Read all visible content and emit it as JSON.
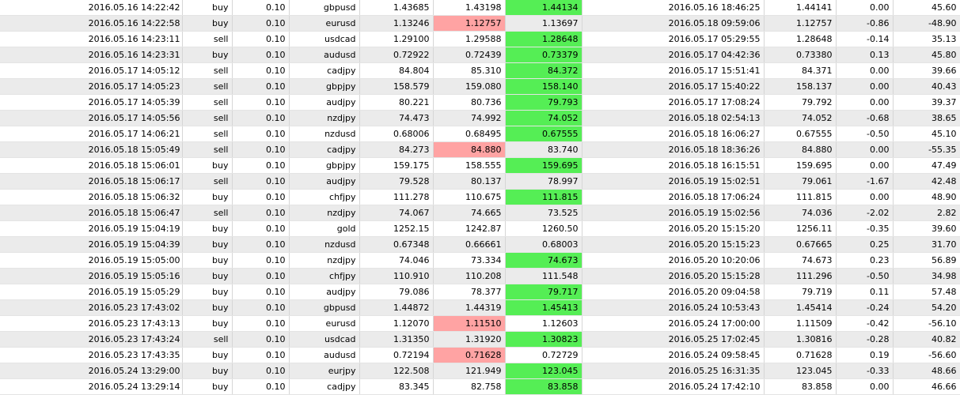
{
  "colors": {
    "alt_row": "#ebebeb",
    "green": "#55ee55",
    "red": "#ffa3a3"
  },
  "rows": [
    {
      "open_time": "2016.05.16 14:22:42",
      "type": "buy",
      "lots": "0.10",
      "symbol": "gbpusd",
      "open_price": "1.43685",
      "sl": "1.43198",
      "tp": "1.44134",
      "close_time": "2016.05.16 18:46:25",
      "close_price": "1.44141",
      "swap": "0.00",
      "profit": "45.60",
      "hl_sl": "",
      "hl_tp": "green"
    },
    {
      "open_time": "2016.05.16 14:22:58",
      "type": "buy",
      "lots": "0.10",
      "symbol": "eurusd",
      "open_price": "1.13246",
      "sl": "1.12757",
      "tp": "1.13697",
      "close_time": "2016.05.18 09:59:06",
      "close_price": "1.12757",
      "swap": "-0.86",
      "profit": "-48.90",
      "hl_sl": "red",
      "hl_tp": ""
    },
    {
      "open_time": "2016.05.16 14:23:11",
      "type": "sell",
      "lots": "0.10",
      "symbol": "usdcad",
      "open_price": "1.29100",
      "sl": "1.29588",
      "tp": "1.28648",
      "close_time": "2016.05.17 05:29:55",
      "close_price": "1.28648",
      "swap": "-0.14",
      "profit": "35.13",
      "hl_sl": "",
      "hl_tp": "green"
    },
    {
      "open_time": "2016.05.16 14:23:31",
      "type": "buy",
      "lots": "0.10",
      "symbol": "audusd",
      "open_price": "0.72922",
      "sl": "0.72439",
      "tp": "0.73379",
      "close_time": "2016.05.17 04:42:36",
      "close_price": "0.73380",
      "swap": "0.13",
      "profit": "45.80",
      "hl_sl": "",
      "hl_tp": "green"
    },
    {
      "open_time": "2016.05.17 14:05:12",
      "type": "sell",
      "lots": "0.10",
      "symbol": "cadjpy",
      "open_price": "84.804",
      "sl": "85.310",
      "tp": "84.372",
      "close_time": "2016.05.17 15:51:41",
      "close_price": "84.371",
      "swap": "0.00",
      "profit": "39.66",
      "hl_sl": "",
      "hl_tp": "green"
    },
    {
      "open_time": "2016.05.17 14:05:23",
      "type": "sell",
      "lots": "0.10",
      "symbol": "gbpjpy",
      "open_price": "158.579",
      "sl": "159.080",
      "tp": "158.140",
      "close_time": "2016.05.17 15:40:22",
      "close_price": "158.137",
      "swap": "0.00",
      "profit": "40.43",
      "hl_sl": "",
      "hl_tp": "green"
    },
    {
      "open_time": "2016.05.17 14:05:39",
      "type": "sell",
      "lots": "0.10",
      "symbol": "audjpy",
      "open_price": "80.221",
      "sl": "80.736",
      "tp": "79.793",
      "close_time": "2016.05.17 17:08:24",
      "close_price": "79.792",
      "swap": "0.00",
      "profit": "39.37",
      "hl_sl": "",
      "hl_tp": "green"
    },
    {
      "open_time": "2016.05.17 14:05:56",
      "type": "sell",
      "lots": "0.10",
      "symbol": "nzdjpy",
      "open_price": "74.473",
      "sl": "74.992",
      "tp": "74.052",
      "close_time": "2016.05.18 02:54:13",
      "close_price": "74.052",
      "swap": "-0.68",
      "profit": "38.65",
      "hl_sl": "",
      "hl_tp": "green"
    },
    {
      "open_time": "2016.05.17 14:06:21",
      "type": "sell",
      "lots": "0.10",
      "symbol": "nzdusd",
      "open_price": "0.68006",
      "sl": "0.68495",
      "tp": "0.67555",
      "close_time": "2016.05.18 16:06:27",
      "close_price": "0.67555",
      "swap": "-0.50",
      "profit": "45.10",
      "hl_sl": "",
      "hl_tp": "green"
    },
    {
      "open_time": "2016.05.18 15:05:49",
      "type": "sell",
      "lots": "0.10",
      "symbol": "cadjpy",
      "open_price": "84.273",
      "sl": "84.880",
      "tp": "83.740",
      "close_time": "2016.05.18 18:36:26",
      "close_price": "84.880",
      "swap": "0.00",
      "profit": "-55.35",
      "hl_sl": "red",
      "hl_tp": ""
    },
    {
      "open_time": "2016.05.18 15:06:01",
      "type": "buy",
      "lots": "0.10",
      "symbol": "gbpjpy",
      "open_price": "159.175",
      "sl": "158.555",
      "tp": "159.695",
      "close_time": "2016.05.18 16:15:51",
      "close_price": "159.695",
      "swap": "0.00",
      "profit": "47.49",
      "hl_sl": "",
      "hl_tp": "green"
    },
    {
      "open_time": "2016.05.18 15:06:17",
      "type": "sell",
      "lots": "0.10",
      "symbol": "audjpy",
      "open_price": "79.528",
      "sl": "80.137",
      "tp": "78.997",
      "close_time": "2016.05.19 15:02:51",
      "close_price": "79.061",
      "swap": "-1.67",
      "profit": "42.48",
      "hl_sl": "",
      "hl_tp": ""
    },
    {
      "open_time": "2016.05.18 15:06:32",
      "type": "buy",
      "lots": "0.10",
      "symbol": "chfjpy",
      "open_price": "111.278",
      "sl": "110.675",
      "tp": "111.815",
      "close_time": "2016.05.18 17:06:24",
      "close_price": "111.815",
      "swap": "0.00",
      "profit": "48.90",
      "hl_sl": "",
      "hl_tp": "green"
    },
    {
      "open_time": "2016.05.18 15:06:47",
      "type": "sell",
      "lots": "0.10",
      "symbol": "nzdjpy",
      "open_price": "74.067",
      "sl": "74.665",
      "tp": "73.525",
      "close_time": "2016.05.19 15:02:56",
      "close_price": "74.036",
      "swap": "-2.02",
      "profit": "2.82",
      "hl_sl": "",
      "hl_tp": ""
    },
    {
      "open_time": "2016.05.19 15:04:19",
      "type": "buy",
      "lots": "0.10",
      "symbol": "gold",
      "open_price": "1252.15",
      "sl": "1242.87",
      "tp": "1260.50",
      "close_time": "2016.05.20 15:15:20",
      "close_price": "1256.11",
      "swap": "-0.35",
      "profit": "39.60",
      "hl_sl": "",
      "hl_tp": ""
    },
    {
      "open_time": "2016.05.19 15:04:39",
      "type": "buy",
      "lots": "0.10",
      "symbol": "nzdusd",
      "open_price": "0.67348",
      "sl": "0.66661",
      "tp": "0.68003",
      "close_time": "2016.05.20 15:15:23",
      "close_price": "0.67665",
      "swap": "0.25",
      "profit": "31.70",
      "hl_sl": "",
      "hl_tp": ""
    },
    {
      "open_time": "2016.05.19 15:05:00",
      "type": "buy",
      "lots": "0.10",
      "symbol": "nzdjpy",
      "open_price": "74.046",
      "sl": "73.334",
      "tp": "74.673",
      "close_time": "2016.05.20 10:20:06",
      "close_price": "74.673",
      "swap": "0.23",
      "profit": "56.89",
      "hl_sl": "",
      "hl_tp": "green"
    },
    {
      "open_time": "2016.05.19 15:05:16",
      "type": "buy",
      "lots": "0.10",
      "symbol": "chfjpy",
      "open_price": "110.910",
      "sl": "110.208",
      "tp": "111.548",
      "close_time": "2016.05.20 15:15:28",
      "close_price": "111.296",
      "swap": "-0.50",
      "profit": "34.98",
      "hl_sl": "",
      "hl_tp": ""
    },
    {
      "open_time": "2016.05.19 15:05:29",
      "type": "buy",
      "lots": "0.10",
      "symbol": "audjpy",
      "open_price": "79.086",
      "sl": "78.377",
      "tp": "79.717",
      "close_time": "2016.05.20 09:04:58",
      "close_price": "79.719",
      "swap": "0.11",
      "profit": "57.48",
      "hl_sl": "",
      "hl_tp": "green"
    },
    {
      "open_time": "2016.05.23 17:43:02",
      "type": "buy",
      "lots": "0.10",
      "symbol": "gbpusd",
      "open_price": "1.44872",
      "sl": "1.44319",
      "tp": "1.45413",
      "close_time": "2016.05.24 10:53:43",
      "close_price": "1.45414",
      "swap": "-0.24",
      "profit": "54.20",
      "hl_sl": "",
      "hl_tp": "green"
    },
    {
      "open_time": "2016.05.23 17:43:13",
      "type": "buy",
      "lots": "0.10",
      "symbol": "eurusd",
      "open_price": "1.12070",
      "sl": "1.11510",
      "tp": "1.12603",
      "close_time": "2016.05.24 17:00:00",
      "close_price": "1.11509",
      "swap": "-0.42",
      "profit": "-56.10",
      "hl_sl": "red",
      "hl_tp": ""
    },
    {
      "open_time": "2016.05.23 17:43:24",
      "type": "sell",
      "lots": "0.10",
      "symbol": "usdcad",
      "open_price": "1.31350",
      "sl": "1.31920",
      "tp": "1.30823",
      "close_time": "2016.05.25 17:02:45",
      "close_price": "1.30816",
      "swap": "-0.28",
      "profit": "40.82",
      "hl_sl": "",
      "hl_tp": "green"
    },
    {
      "open_time": "2016.05.23 17:43:35",
      "type": "buy",
      "lots": "0.10",
      "symbol": "audusd",
      "open_price": "0.72194",
      "sl": "0.71628",
      "tp": "0.72729",
      "close_time": "2016.05.24 09:58:45",
      "close_price": "0.71628",
      "swap": "0.19",
      "profit": "-56.60",
      "hl_sl": "red",
      "hl_tp": ""
    },
    {
      "open_time": "2016.05.24 13:29:00",
      "type": "buy",
      "lots": "0.10",
      "symbol": "eurjpy",
      "open_price": "122.508",
      "sl": "121.949",
      "tp": "123.045",
      "close_time": "2016.05.25 16:31:35",
      "close_price": "123.045",
      "swap": "-0.33",
      "profit": "48.66",
      "hl_sl": "",
      "hl_tp": "green"
    },
    {
      "open_time": "2016.05.24 13:29:14",
      "type": "buy",
      "lots": "0.10",
      "symbol": "cadjpy",
      "open_price": "83.345",
      "sl": "82.758",
      "tp": "83.858",
      "close_time": "2016.05.24 17:42:10",
      "close_price": "83.858",
      "swap": "0.00",
      "profit": "46.66",
      "hl_sl": "",
      "hl_tp": "green"
    }
  ]
}
